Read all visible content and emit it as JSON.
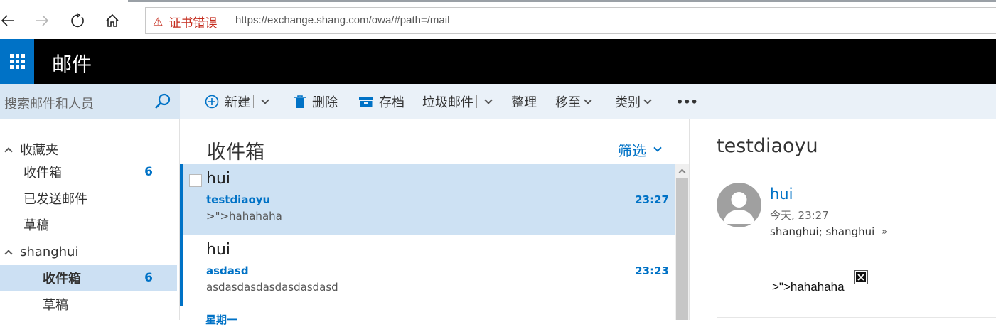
{
  "browser": {
    "cert_error": "证书错误",
    "url": "https://exchange.shang.com/owa/#path=/mail"
  },
  "app": {
    "title": "邮件"
  },
  "search": {
    "placeholder": "搜索邮件和人员"
  },
  "toolbar": {
    "new_label": "新建",
    "delete_label": "删除",
    "archive_label": "存档",
    "junk_label": "垃圾邮件",
    "sweep_label": "整理",
    "move_label": "移至",
    "categorize_label": "类别",
    "more_label": "•••"
  },
  "folders": {
    "favorites_label": "收藏夹",
    "favorites": [
      {
        "label": "收件箱",
        "count": "6"
      },
      {
        "label": "已发送邮件",
        "count": ""
      },
      {
        "label": "草稿",
        "count": ""
      }
    ],
    "account_label": "shanghui",
    "account": [
      {
        "label": "收件箱",
        "count": "6"
      },
      {
        "label": "草稿",
        "count": ""
      }
    ]
  },
  "list": {
    "title": "收件箱",
    "filter_label": "筛选",
    "messages": [
      {
        "sender": "hui",
        "subject": "testdiaoyu",
        "time": "23:27",
        "preview": ">\">hahahaha"
      },
      {
        "sender": "hui",
        "subject": "asdasd",
        "time": "23:23",
        "preview": "asdasdasdasdasdasdasd"
      }
    ],
    "next_group": "星期一"
  },
  "reading": {
    "subject": "testdiaoyu",
    "sender": "hui",
    "date": "今天, 23:27",
    "recipients": "shanghui; shanghui",
    "body": ">\">hahahaha"
  },
  "colors": {
    "accent": "#0072c6",
    "header_bg": "#000000",
    "selected_bg": "#cde1f3",
    "cert_error": "#c42b1c"
  }
}
